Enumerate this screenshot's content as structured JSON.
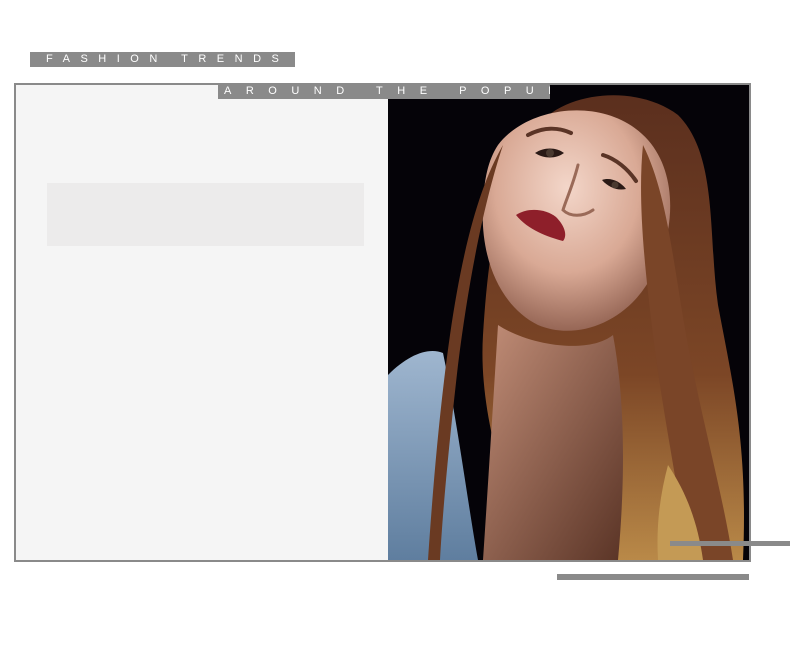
{
  "tags": {
    "top": "FASHION TRENDS",
    "middle": "AROUND THE POPULAR"
  },
  "photo": {
    "subject": "portrait-photo"
  },
  "colors": {
    "accent_gray": "#8a8a8a",
    "panel": "#f5f5f5",
    "placeholder": "#ecebeb",
    "photo_background": "#050308"
  }
}
